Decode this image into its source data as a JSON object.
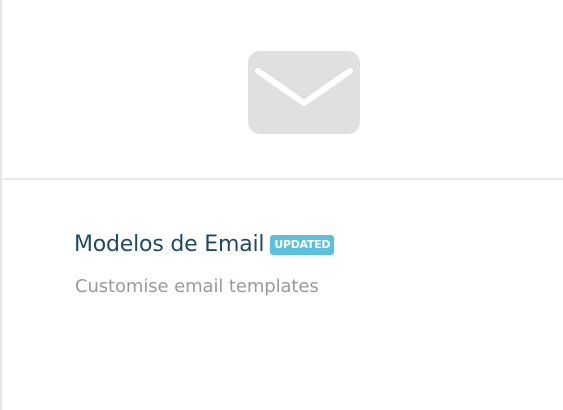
{
  "card": {
    "icon": "envelope-icon",
    "title": "Modelos de Email",
    "badge": "UPDATED",
    "description": "Customise email templates"
  },
  "colors": {
    "title": "#1f4a66",
    "badge_bg": "#5bc0de",
    "description": "#9a9a9a",
    "icon": "#e0e0e0"
  }
}
